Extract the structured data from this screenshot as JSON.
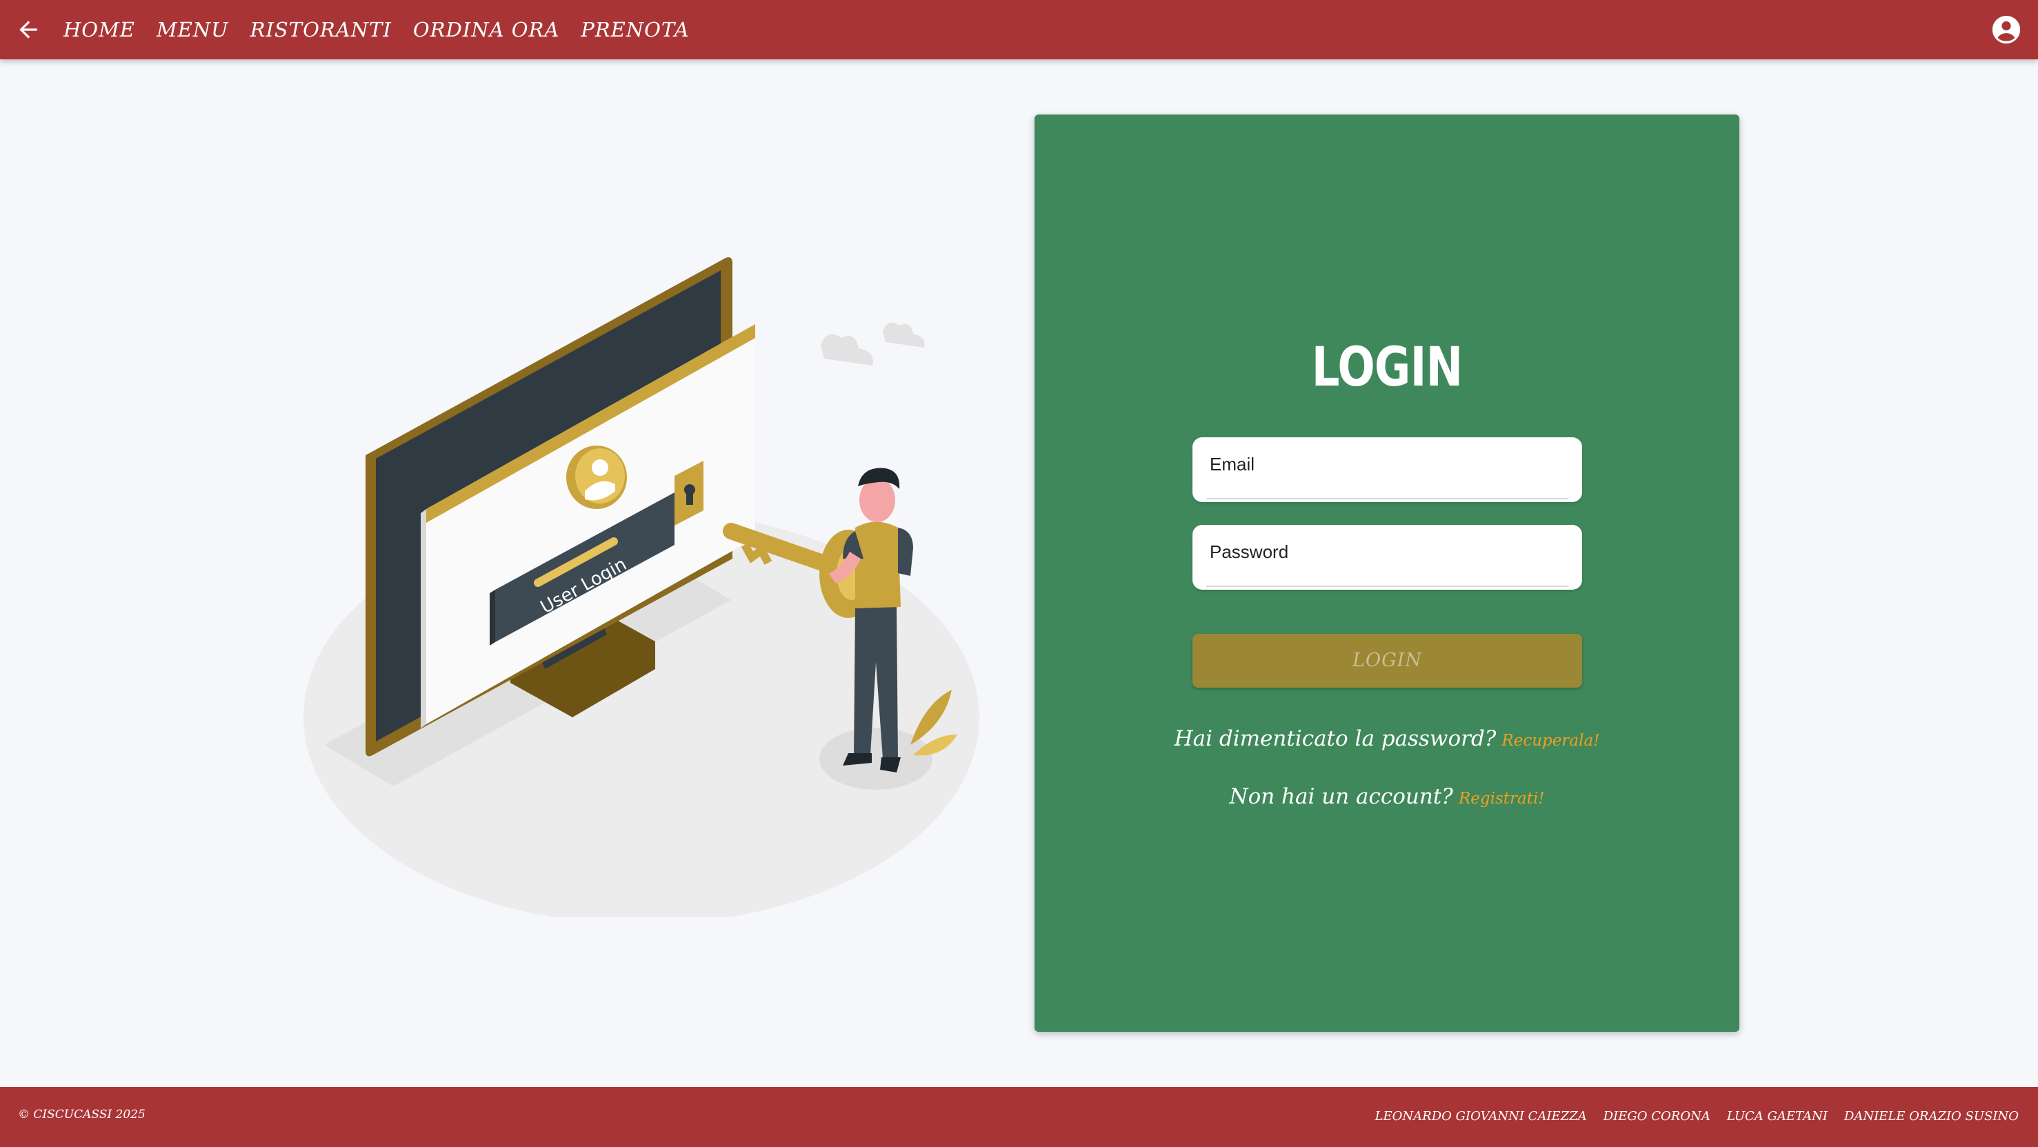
{
  "nav": {
    "back_icon": "arrow-left-icon",
    "items": [
      "HOME",
      "MENU",
      "RISTORANTI",
      "ORDINA ORA",
      "PRENOTA"
    ],
    "account_icon": "account-circle-icon"
  },
  "illustration": {
    "screen_text": "User Login"
  },
  "login_card": {
    "title": "LOGIN",
    "email_label": "Email",
    "password_label": "Password",
    "submit_label": "LOGIN",
    "forgot_text": "Hai dimenticato la password?",
    "forgot_link": "Recuperala!",
    "register_text": "Non hai un account?",
    "register_link": "Registrati!"
  },
  "footer": {
    "copyright": "© CISCUCASSI 2025",
    "authors": [
      "LEONARDO GIOVANNI CAIEZZA",
      "DIEGO CORONA",
      "LUCA GAETANI",
      "DANIELE ORAZIO SUSINO"
    ]
  },
  "colors": {
    "header": "#a93436",
    "card": "#3f885c",
    "button": "#9c8735",
    "link": "#f0a020",
    "background": "#f6f7fb"
  }
}
